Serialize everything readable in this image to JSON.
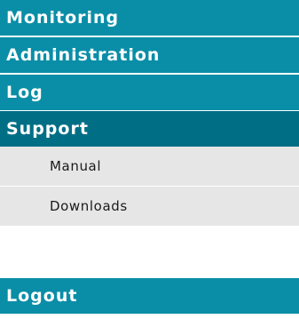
{
  "colors": {
    "menu_item_bg": "#0a8ea7",
    "menu_item_active_bg": "#006f86",
    "menu_item_text": "#ffffff",
    "submenu_bg": "#e6e6e6",
    "submenu_text": "#1a1a1a"
  },
  "menu": {
    "monitoring": "Monitoring",
    "administration": "Administration",
    "log": "Log",
    "support": "Support",
    "support_items": {
      "manual": "Manual",
      "downloads": "Downloads"
    },
    "logout": "Logout"
  }
}
